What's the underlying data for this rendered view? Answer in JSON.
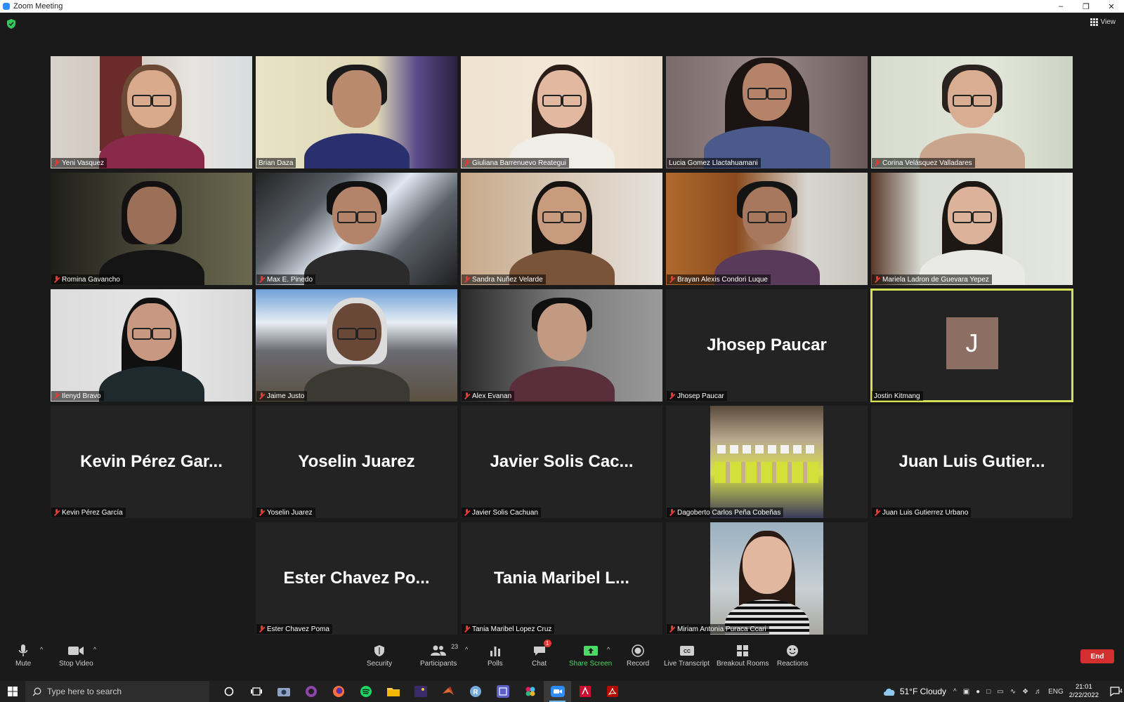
{
  "window": {
    "title": "Zoom Meeting",
    "controls": [
      "–",
      "❐",
      "✕"
    ]
  },
  "view_button": {
    "label": "View"
  },
  "participants": [
    {
      "name": "Yeni Vasquez",
      "mic_muted": true,
      "video": "on"
    },
    {
      "name": "Brian Daza",
      "mic_muted": false,
      "video": "on"
    },
    {
      "name": "Giuliana Barrenuevo Reategui",
      "mic_muted": true,
      "video": "on"
    },
    {
      "name": "Lucia Gomez Llactahuamani",
      "mic_muted": false,
      "video": "on"
    },
    {
      "name": "Corina Velásquez Valladares",
      "mic_muted": true,
      "video": "on"
    },
    {
      "name": "Romina Gavancho",
      "mic_muted": true,
      "video": "on"
    },
    {
      "name": "Max E. Pinedo",
      "mic_muted": true,
      "video": "on"
    },
    {
      "name": "Sandra Nuñez Velarde",
      "mic_muted": true,
      "video": "on"
    },
    {
      "name": "Brayan Alexis Condori Luque",
      "mic_muted": true,
      "video": "on"
    },
    {
      "name": "Mariela Ladron de Guevara Yepez",
      "mic_muted": true,
      "video": "on"
    },
    {
      "name": "Ilenyd Bravo",
      "mic_muted": true,
      "video": "on"
    },
    {
      "name": "Jaime Justo",
      "mic_muted": true,
      "video": "on"
    },
    {
      "name": "Alex Evanan",
      "mic_muted": true,
      "video": "on"
    },
    {
      "name": "Jhosep Paucar",
      "display": "Jhosep Paucar",
      "mic_muted": true,
      "video": "off"
    },
    {
      "name": "Jostin Kitmang",
      "initial": "J",
      "mic_muted": false,
      "video": "off",
      "active_speaker": true
    },
    {
      "name": "Kevin Pérez García",
      "display": "Kevin Pérez Gar...",
      "mic_muted": true,
      "video": "off"
    },
    {
      "name": "Yoselin Juarez",
      "display": "Yoselin Juarez",
      "mic_muted": true,
      "video": "off"
    },
    {
      "name": "Javier Solis Cachuan",
      "display": "Javier Solis Cac...",
      "mic_muted": true,
      "video": "off"
    },
    {
      "name": "Dagoberto Carlos Peña Cobeñas",
      "mic_muted": true,
      "video": "photo"
    },
    {
      "name": "Juan Luis Gutierrez Urbano",
      "display": "Juan Luis Gutier...",
      "mic_muted": true,
      "video": "off"
    },
    {
      "name": "Ester Chavez Poma",
      "display": "Ester Chavez Po...",
      "mic_muted": true,
      "video": "off"
    },
    {
      "name": "Tania Maribel Lopez Cruz",
      "display": "Tania Maribel L...",
      "mic_muted": true,
      "video": "off"
    },
    {
      "name": "Miriam Antonia Puraca Ccari",
      "mic_muted": true,
      "video": "photo"
    }
  ],
  "toolbar": {
    "mute": "Mute",
    "stop_video": "Stop Video",
    "security": "Security",
    "participants": "Participants",
    "participants_count": "23",
    "polls": "Polls",
    "chat": "Chat",
    "chat_badge": "1",
    "share_screen": "Share Screen",
    "record": "Record",
    "live_transcript": "Live Transcript",
    "breakout_rooms": "Breakout Rooms",
    "reactions": "Reactions",
    "end": "End"
  },
  "taskbar": {
    "search_placeholder": "Type here to search",
    "weather": "51°F  Cloudy",
    "language": "ENG",
    "time": "21:01",
    "date": "2/22/2022",
    "notification_count": "4"
  },
  "colors": {
    "accent_active": "#d4e157",
    "end_red": "#d32f2f",
    "share_green": "#4cd964",
    "muted_red": "#e53935"
  }
}
